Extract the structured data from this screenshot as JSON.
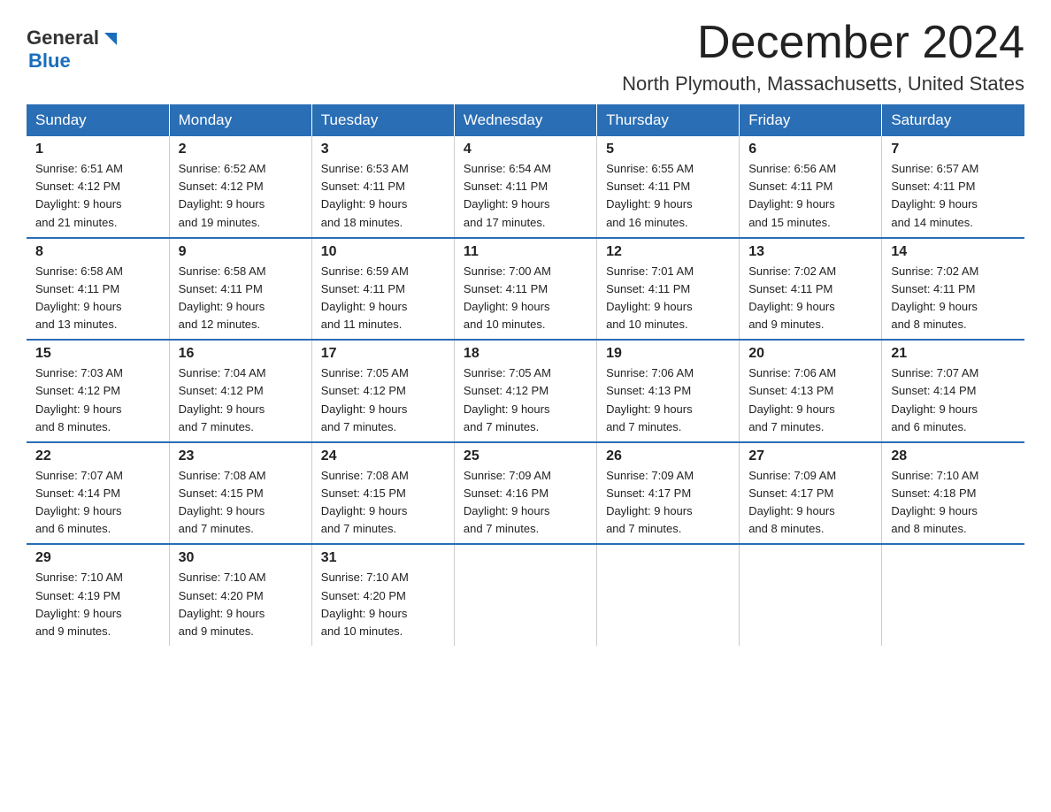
{
  "header": {
    "logo_general": "General",
    "logo_blue": "Blue",
    "month_title": "December 2024",
    "location": "North Plymouth, Massachusetts, United States"
  },
  "calendar": {
    "days_of_week": [
      "Sunday",
      "Monday",
      "Tuesday",
      "Wednesday",
      "Thursday",
      "Friday",
      "Saturday"
    ],
    "weeks": [
      [
        {
          "day": "1",
          "sunrise": "6:51 AM",
          "sunset": "4:12 PM",
          "daylight": "9 hours and 21 minutes."
        },
        {
          "day": "2",
          "sunrise": "6:52 AM",
          "sunset": "4:12 PM",
          "daylight": "9 hours and 19 minutes."
        },
        {
          "day": "3",
          "sunrise": "6:53 AM",
          "sunset": "4:11 PM",
          "daylight": "9 hours and 18 minutes."
        },
        {
          "day": "4",
          "sunrise": "6:54 AM",
          "sunset": "4:11 PM",
          "daylight": "9 hours and 17 minutes."
        },
        {
          "day": "5",
          "sunrise": "6:55 AM",
          "sunset": "4:11 PM",
          "daylight": "9 hours and 16 minutes."
        },
        {
          "day": "6",
          "sunrise": "6:56 AM",
          "sunset": "4:11 PM",
          "daylight": "9 hours and 15 minutes."
        },
        {
          "day": "7",
          "sunrise": "6:57 AM",
          "sunset": "4:11 PM",
          "daylight": "9 hours and 14 minutes."
        }
      ],
      [
        {
          "day": "8",
          "sunrise": "6:58 AM",
          "sunset": "4:11 PM",
          "daylight": "9 hours and 13 minutes."
        },
        {
          "day": "9",
          "sunrise": "6:58 AM",
          "sunset": "4:11 PM",
          "daylight": "9 hours and 12 minutes."
        },
        {
          "day": "10",
          "sunrise": "6:59 AM",
          "sunset": "4:11 PM",
          "daylight": "9 hours and 11 minutes."
        },
        {
          "day": "11",
          "sunrise": "7:00 AM",
          "sunset": "4:11 PM",
          "daylight": "9 hours and 10 minutes."
        },
        {
          "day": "12",
          "sunrise": "7:01 AM",
          "sunset": "4:11 PM",
          "daylight": "9 hours and 10 minutes."
        },
        {
          "day": "13",
          "sunrise": "7:02 AM",
          "sunset": "4:11 PM",
          "daylight": "9 hours and 9 minutes."
        },
        {
          "day": "14",
          "sunrise": "7:02 AM",
          "sunset": "4:11 PM",
          "daylight": "9 hours and 8 minutes."
        }
      ],
      [
        {
          "day": "15",
          "sunrise": "7:03 AM",
          "sunset": "4:12 PM",
          "daylight": "9 hours and 8 minutes."
        },
        {
          "day": "16",
          "sunrise": "7:04 AM",
          "sunset": "4:12 PM",
          "daylight": "9 hours and 7 minutes."
        },
        {
          "day": "17",
          "sunrise": "7:05 AM",
          "sunset": "4:12 PM",
          "daylight": "9 hours and 7 minutes."
        },
        {
          "day": "18",
          "sunrise": "7:05 AM",
          "sunset": "4:12 PM",
          "daylight": "9 hours and 7 minutes."
        },
        {
          "day": "19",
          "sunrise": "7:06 AM",
          "sunset": "4:13 PM",
          "daylight": "9 hours and 7 minutes."
        },
        {
          "day": "20",
          "sunrise": "7:06 AM",
          "sunset": "4:13 PM",
          "daylight": "9 hours and 7 minutes."
        },
        {
          "day": "21",
          "sunrise": "7:07 AM",
          "sunset": "4:14 PM",
          "daylight": "9 hours and 6 minutes."
        }
      ],
      [
        {
          "day": "22",
          "sunrise": "7:07 AM",
          "sunset": "4:14 PM",
          "daylight": "9 hours and 6 minutes."
        },
        {
          "day": "23",
          "sunrise": "7:08 AM",
          "sunset": "4:15 PM",
          "daylight": "9 hours and 7 minutes."
        },
        {
          "day": "24",
          "sunrise": "7:08 AM",
          "sunset": "4:15 PM",
          "daylight": "9 hours and 7 minutes."
        },
        {
          "day": "25",
          "sunrise": "7:09 AM",
          "sunset": "4:16 PM",
          "daylight": "9 hours and 7 minutes."
        },
        {
          "day": "26",
          "sunrise": "7:09 AM",
          "sunset": "4:17 PM",
          "daylight": "9 hours and 7 minutes."
        },
        {
          "day": "27",
          "sunrise": "7:09 AM",
          "sunset": "4:17 PM",
          "daylight": "9 hours and 8 minutes."
        },
        {
          "day": "28",
          "sunrise": "7:10 AM",
          "sunset": "4:18 PM",
          "daylight": "9 hours and 8 minutes."
        }
      ],
      [
        {
          "day": "29",
          "sunrise": "7:10 AM",
          "sunset": "4:19 PM",
          "daylight": "9 hours and 9 minutes."
        },
        {
          "day": "30",
          "sunrise": "7:10 AM",
          "sunset": "4:20 PM",
          "daylight": "9 hours and 9 minutes."
        },
        {
          "day": "31",
          "sunrise": "7:10 AM",
          "sunset": "4:20 PM",
          "daylight": "9 hours and 10 minutes."
        },
        null,
        null,
        null,
        null
      ]
    ],
    "label_sunrise": "Sunrise:",
    "label_sunset": "Sunset:",
    "label_daylight": "Daylight:"
  }
}
